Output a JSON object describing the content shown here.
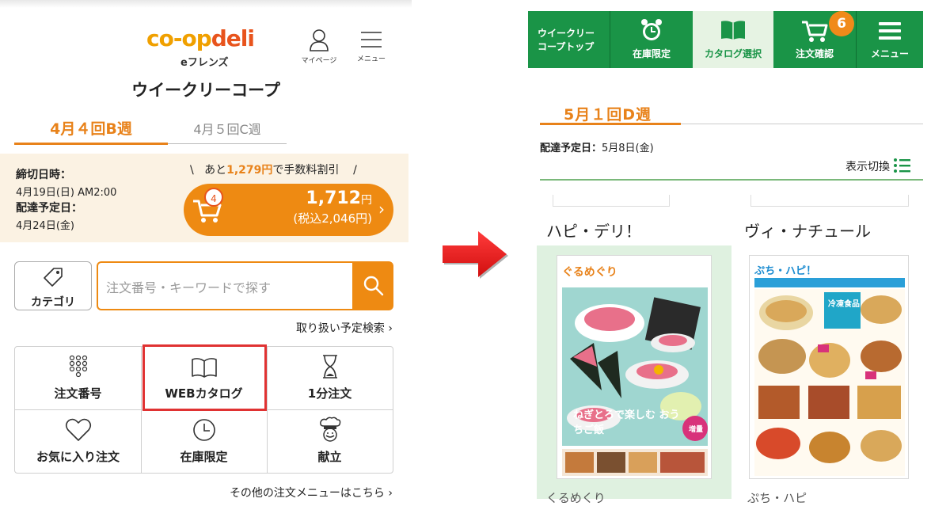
{
  "left": {
    "logo_a": "co-op",
    "logo_b": "deli",
    "subbrand": "eフレンズ",
    "mypage_label": "マイページ",
    "menu_label": "メニュー",
    "site_title": "ウイークリーコープ",
    "tabs": [
      {
        "label": "4月４回B週",
        "active": true
      },
      {
        "label": "4月５回C週",
        "active": false
      }
    ],
    "deadline_label": "締切日時：",
    "deadline_value": "4月19日(日) AM2:00",
    "delivery_label": "配達予定日：",
    "delivery_value": "4月24日(金)",
    "discount_pre": "あと",
    "discount_amount": "1,279円",
    "discount_post": "で手数料割引",
    "cart_count": "4",
    "cart_total": "1,712",
    "cart_yen": "円",
    "cart_tax": "(税込2,046円)",
    "category_label": "カテゴリ",
    "search_placeholder": "注文番号・キーワードで探す",
    "schedule_link": "取り扱い予定検索",
    "grid": [
      {
        "label": "注文番号",
        "icon": "dial-pad-icon"
      },
      {
        "label": "WEBカタログ",
        "icon": "open-book-icon",
        "highlighted": true
      },
      {
        "label": "1分注文",
        "icon": "hourglass-icon"
      },
      {
        "label": "お気に入り注文",
        "icon": "heart-icon"
      },
      {
        "label": "在庫限定",
        "icon": "clock-icon"
      },
      {
        "label": "献立",
        "icon": "chef-icon"
      }
    ],
    "more_link": "その他の注文メニューはこちら"
  },
  "right": {
    "nav": [
      {
        "label_line1": "ウイークリー",
        "label_line2": "コープトップ"
      },
      {
        "label": "在庫限定",
        "icon": "alarm-clock-icon"
      },
      {
        "label": "カタログ選択",
        "icon": "book-icon",
        "active": true
      },
      {
        "label": "注文確認",
        "icon": "cart-icon",
        "badge": "6"
      },
      {
        "label": "メニュー",
        "icon": "hamburger-icon"
      }
    ],
    "week_title": "5月１回D週",
    "delivery_label": "配達予定日：",
    "delivery_value": "5月8日(金)",
    "toggle_label": "表示切換",
    "catalogs": [
      {
        "name": "ハピ・デリ！",
        "cover_title": "ぐるめぐり",
        "cover_caption": "ねぎとろで楽しむ おうちご飯",
        "cover_badge": "増量",
        "bottom_text": "くるめくり"
      },
      {
        "name": "ヴィ・ナチュール",
        "cover_title": "ぷち・ハピ！",
        "cover_caption": "冷凍食品",
        "bottom_text": "ぷち・ハピ"
      }
    ],
    "colors": {
      "green": "#1a9447",
      "orange": "#e8821a",
      "nav_active_bg": "#e6f3e3"
    }
  }
}
